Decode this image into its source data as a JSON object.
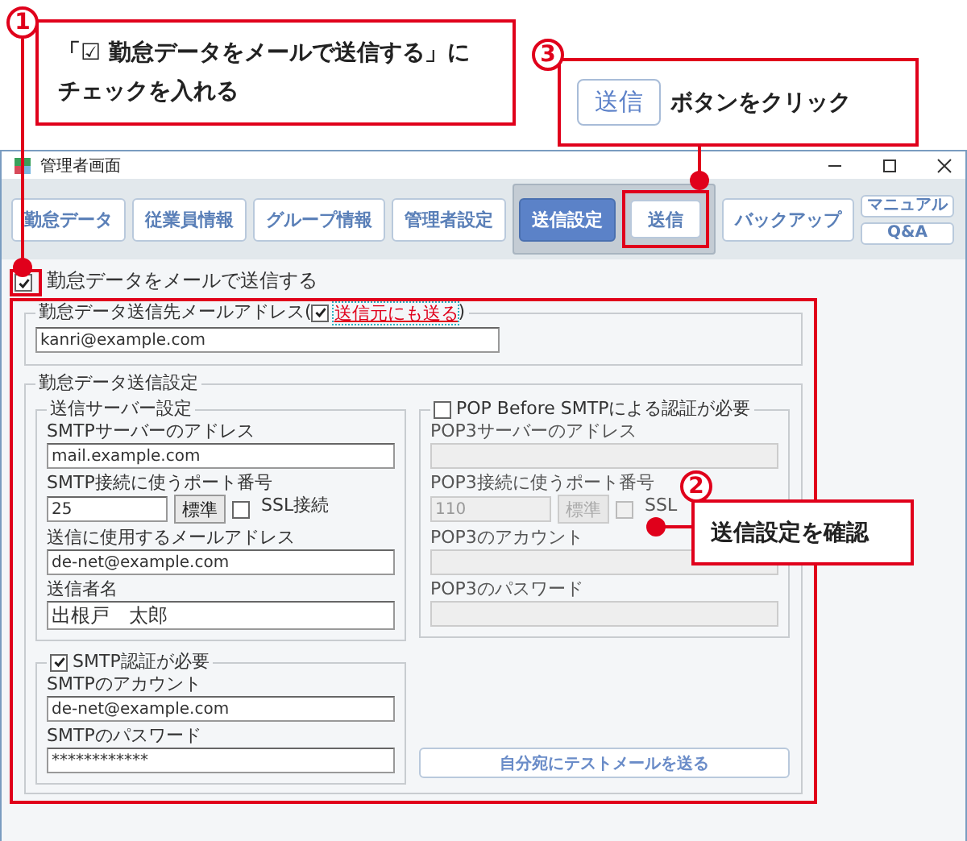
{
  "step_1": {
    "number": "1",
    "lines": [
      "「☑ 勤怠データをメールで送信する」に",
      "チェックを入れる"
    ]
  },
  "step_3": {
    "number": "3",
    "button_label": "送信",
    "text": "ボタンをクリック"
  },
  "window": {
    "title": "管理者画面"
  },
  "toolbar": {
    "buttons": [
      {
        "label": "勤怠データ",
        "selected": false
      },
      {
        "label": "従業員情報",
        "selected": false
      },
      {
        "label": "グループ情報",
        "selected": false
      },
      {
        "label": "管理者設定",
        "selected": false
      }
    ],
    "send_group": [
      {
        "label": "送信設定",
        "selected": true
      },
      {
        "label": "送信",
        "selected": false
      }
    ],
    "backup": {
      "label": "バックアップ",
      "selected": false
    },
    "help_buttons": [
      "マニュアル",
      "Q&A"
    ]
  },
  "form": {
    "send_mail": {
      "label": "勤怠データをメールで送信する",
      "checked": true
    },
    "recipient": {
      "legend": "勤怠データ送信先メールアドレス(",
      "cc_checked": true,
      "cc_link": "送信元にも送る",
      "legend_end": ")",
      "value": "kanri@example.com"
    },
    "settings": {
      "legend": "勤怠データ送信設定",
      "smtp": {
        "legend": "送信サーバー設定",
        "address_label": "SMTPサーバーのアドレス",
        "address": "mail.example.com",
        "port_label": "SMTP接続に使うポート番号",
        "port": "25",
        "default_button": "標準",
        "ssl": {
          "label": "SSL接続",
          "checked": false
        },
        "from_label": "送信に使用するメールアドレス",
        "from": "de-net@example.com",
        "sender_label": "送信者名",
        "sender": "出根戸　太郎"
      },
      "pop": {
        "label": "POP Before SMTPによる認証が必要",
        "checked": false,
        "address_label": "POP3サーバーのアドレス",
        "port_label": "POP3接続に使うポート番号",
        "port": "110",
        "default_button": "標準",
        "ssl": {
          "label": "SSL",
          "checked": false
        },
        "account_label": "POP3のアカウント",
        "password_label": "POP3のパスワード"
      },
      "auth": {
        "label": "SMTP認証が必要",
        "checked": true,
        "account_label": "SMTPのアカウント",
        "account": "de-net@example.com",
        "password_label": "SMTPのパスワード",
        "password": "************"
      },
      "test_button": "自分宛にテストメールを送る"
    }
  },
  "step_2": {
    "number": "2",
    "text": "送信設定を確認"
  }
}
